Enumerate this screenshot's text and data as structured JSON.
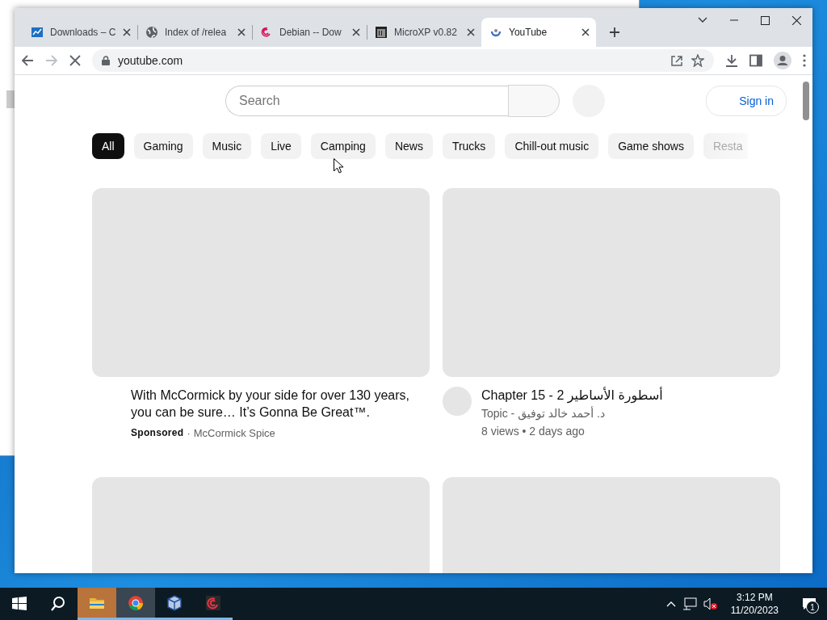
{
  "browser": {
    "tabs": [
      {
        "title": "Downloads – C",
        "selected": false
      },
      {
        "title": "Index of /relea",
        "selected": false
      },
      {
        "title": "Debian -- Dow",
        "selected": false
      },
      {
        "title": "MicroXP v0.82",
        "selected": false
      },
      {
        "title": "YouTube",
        "selected": true
      }
    ],
    "address": "youtube.com",
    "loading": true
  },
  "page": {
    "search": {
      "placeholder": "Search"
    },
    "sign_in": "Sign in",
    "chips": [
      {
        "label": "All",
        "selected": true
      },
      {
        "label": "Gaming",
        "selected": false
      },
      {
        "label": "Music",
        "selected": false
      },
      {
        "label": "Live",
        "selected": false
      },
      {
        "label": "Camping",
        "selected": false
      },
      {
        "label": "News",
        "selected": false
      },
      {
        "label": "Trucks",
        "selected": false
      },
      {
        "label": "Chill-out music",
        "selected": false
      },
      {
        "label": "Game shows",
        "selected": false
      },
      {
        "label": "Resta",
        "selected": false
      }
    ],
    "videos": [
      {
        "kind": "ad",
        "title": "With McCormick by your side for over 130 years, you can be sure… It’s Gonna Be Great™.",
        "badge": "Sponsored",
        "separator": "·",
        "channel": "McCormick Spice"
      },
      {
        "kind": "video",
        "title": "Chapter 15 - 2 أسطورة الأساطير",
        "channel": "Topic - د. أحمد خالد توفيق",
        "meta": "8 views • 2 days ago"
      },
      {
        "kind": "placeholder"
      },
      {
        "kind": "placeholder"
      }
    ]
  },
  "taskbar": {
    "time": "3:12 PM",
    "date": "11/20/2023",
    "notifications": "1"
  }
}
